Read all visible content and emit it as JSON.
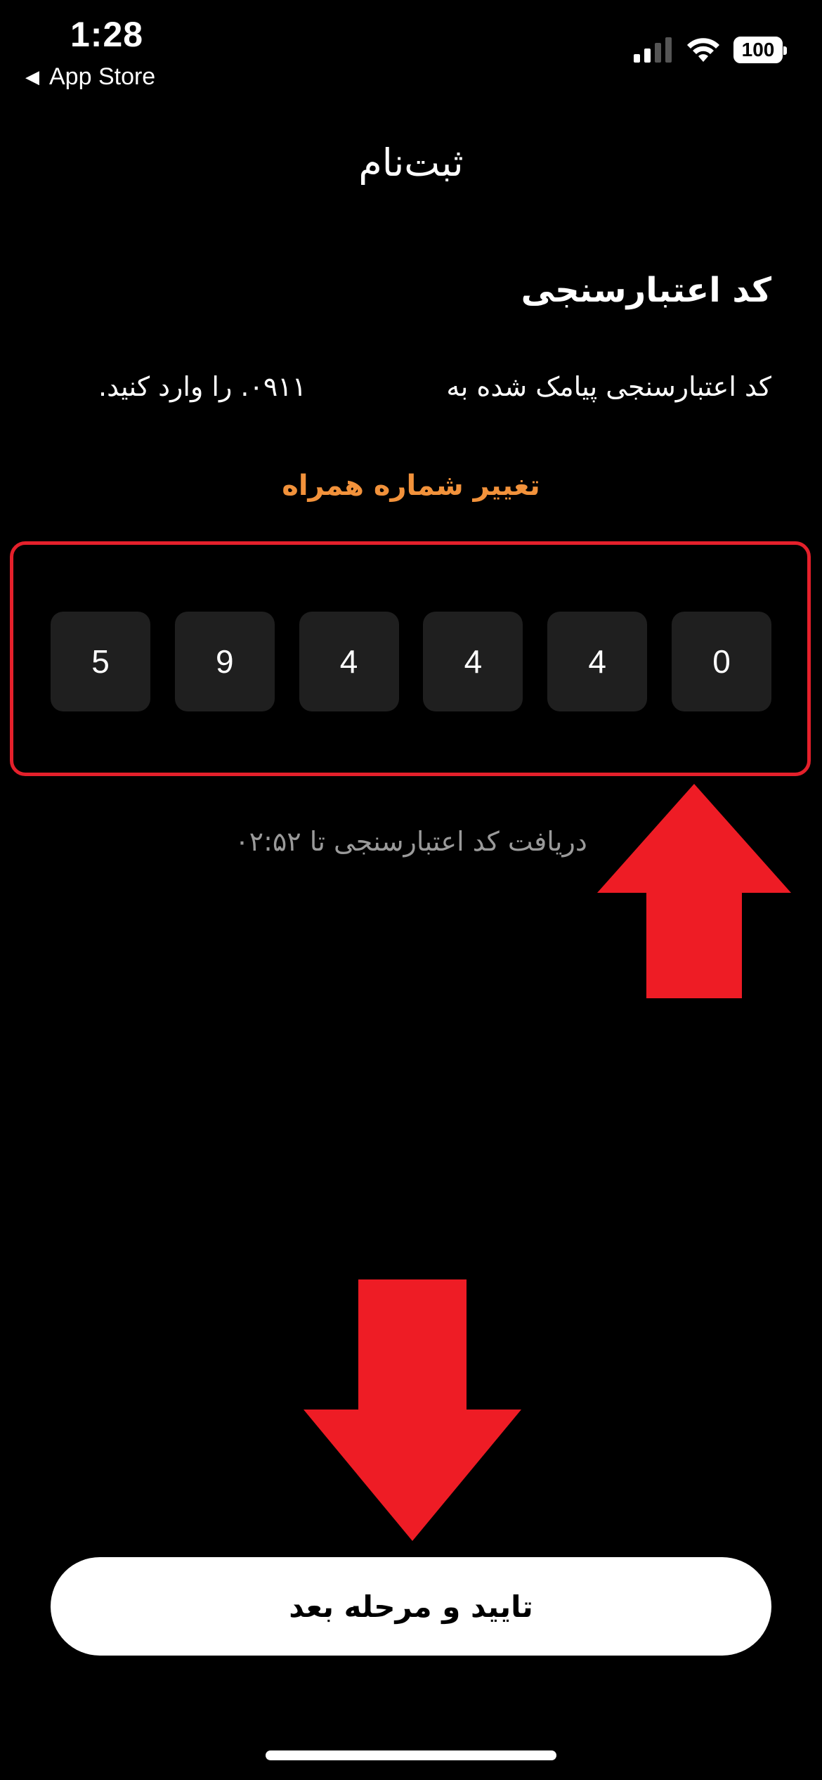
{
  "status_bar": {
    "time": "1:28",
    "back_label": "App Store",
    "battery": "100"
  },
  "page": {
    "title": "ثبت‌نام",
    "section_title": "کد اعتبارسنجی",
    "instruction_start": "کد اعتبارسنجی پیامک شده به",
    "instruction_end": "۰۹۱۱. را وارد کنید.",
    "change_number_label": "تغییر شماره همراه",
    "timer_text": "دریافت کد اعتبارسنجی تا ۰۲:۵۲"
  },
  "otp": {
    "digits": [
      "5",
      "9",
      "4",
      "4",
      "4",
      "0"
    ]
  },
  "actions": {
    "confirm_label": "تایید و مرحله بعد"
  },
  "icons": {
    "back": "back-triangle-icon",
    "signal": "cellular-signal-icon",
    "wifi": "wifi-icon",
    "battery": "battery-icon",
    "arrow_up": "red-arrow-up-icon",
    "arrow_down": "red-arrow-down-icon"
  },
  "colors": {
    "background": "#000000",
    "accent_orange": "#f2923b",
    "highlight_red": "#e5202b",
    "otp_box": "#1f1f1f"
  }
}
